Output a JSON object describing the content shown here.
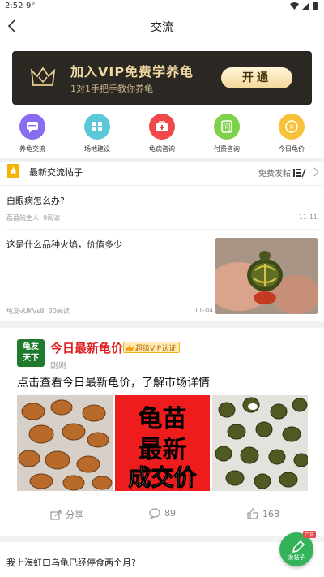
{
  "status_bar": {
    "time": "2:52",
    "temp": "9°"
  },
  "header": {
    "title": "交流"
  },
  "vip_banner": {
    "title": "加入VIP免费学养龟",
    "subtitle": "1对1手把手教你养龟",
    "button": "开通"
  },
  "quick_nav": [
    {
      "label": "养龟交流",
      "icon": "chat-icon",
      "color": "#8b6cf0"
    },
    {
      "label": "场地建设",
      "icon": "grid-icon",
      "color": "#5bc8d8"
    },
    {
      "label": "龟病咨询",
      "icon": "medical-kit-icon",
      "color": "#f0484a"
    },
    {
      "label": "付费咨询",
      "icon": "question-icon",
      "color": "#7ed14a"
    },
    {
      "label": "今日龟价",
      "icon": "yuan-coin-icon",
      "color": "#f8c13a"
    }
  ],
  "section": {
    "title": "最新交流帖子",
    "post_label": "免费发帖"
  },
  "posts": [
    {
      "question": "白眼病怎么办?",
      "author": "荔荔的主人",
      "views": "9阅读",
      "date": "11-11"
    },
    {
      "question": "这是什么品种火焰，价值多少",
      "author": "龟友vUKVs8",
      "views": "30阅读",
      "date": "11-04"
    }
  ],
  "featured": {
    "logo_text": "龟友天下",
    "name": "今日最新龟价",
    "badge": "超级VIP认证",
    "time": "刚刚",
    "text": "点击查看今日最新龟价，了解市场详情",
    "image_text": [
      "龟苗",
      "最新",
      "成交价"
    ],
    "share_label": "分享",
    "comments": "89",
    "likes": "168"
  },
  "last_post": {
    "question": "我上海虹口乌龟已经停食两个月?"
  },
  "fab": {
    "label": "发帖子",
    "tag": "广告"
  }
}
